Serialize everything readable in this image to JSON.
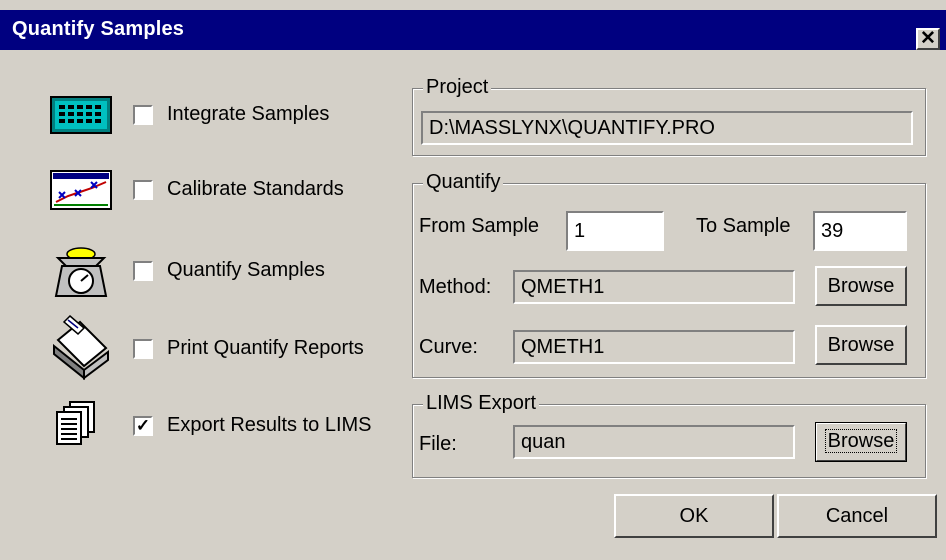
{
  "window": {
    "title": "Quantify Samples",
    "close_glyph": "✕"
  },
  "steps": [
    {
      "icon": "calculator-icon",
      "label": "Integrate Samples",
      "checked": false
    },
    {
      "icon": "calibration-chart-icon",
      "label": "Calibrate Standards",
      "checked": false
    },
    {
      "icon": "scale-icon",
      "label": "Quantify Samples",
      "checked": false
    },
    {
      "icon": "printer-icon",
      "label": "Print Quantify Reports",
      "checked": false
    },
    {
      "icon": "documents-icon",
      "label": "Export Results to LIMS",
      "checked": true
    }
  ],
  "project": {
    "title": "Project",
    "path": "D:\\MASSLYNX\\QUANTIFY.PRO"
  },
  "quantify": {
    "title": "Quantify",
    "from_label": "From Sample",
    "from_value": "1",
    "to_label": "To Sample",
    "to_value": "39",
    "method_label": "Method:",
    "method_value": "QMETH1",
    "curve_label": "Curve:",
    "curve_value": "QMETH1",
    "browse_label": "Browse"
  },
  "lims": {
    "title": "LIMS Export",
    "file_label": "File:",
    "file_value": "quan",
    "browse_label": "Browse"
  },
  "buttons": {
    "ok": "OK",
    "cancel": "Cancel"
  },
  "check_glyph": "✓"
}
